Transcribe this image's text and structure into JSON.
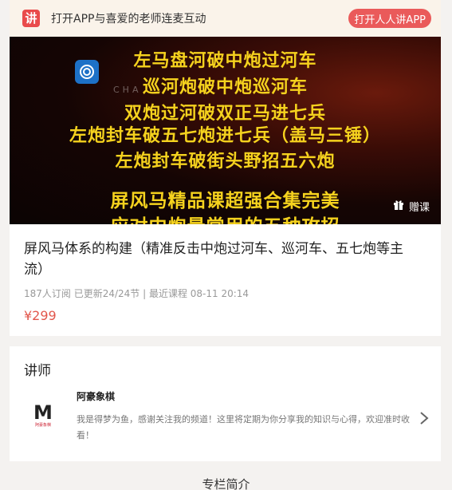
{
  "topbar": {
    "logo_char": "讲",
    "promo_text": "打开APP与喜爱的老师连麦互动",
    "open_app_label": "打开人人讲APP"
  },
  "cover": {
    "lines": [
      "左马盘河破中炮过河车",
      "巡河炮破中炮巡河车",
      "双炮过河破双正马进七兵",
      "左炮封车破五七炮进七兵（盖马三锤）",
      "左炮封车破街头野招五六炮",
      "屏风马精品课超强合集完美",
      "应对中炮最常用的五种攻招"
    ],
    "watermark_text": "CHA",
    "gift_label": "赠课"
  },
  "course": {
    "title": "屏风马体系的构建（精准反击中炮过河车、巡河车、五七炮等主流）",
    "meta": "187人订阅   已更新24/24节 | 最近课程 08-11 20:14",
    "price": "¥299"
  },
  "teacher": {
    "heading": "讲师",
    "name": "阿豪象棋",
    "bio": "我是得梦为鱼，感谢关注我的频道！这里将定期为你分享我的知识与心得，欢迎准时收看！",
    "avatar_letter": "M",
    "avatar_caption": "阿豪象棋"
  },
  "next_section": {
    "title": "专栏简介"
  },
  "colors": {
    "accent": "#ea5a5a",
    "price": "#e2574c",
    "cover_text": "#f5d21e",
    "banner_bg": "#faf3ea"
  },
  "icons": [
    "app-logo-icon",
    "watermark-logo-icon",
    "gift-icon",
    "chevron-right-icon"
  ]
}
